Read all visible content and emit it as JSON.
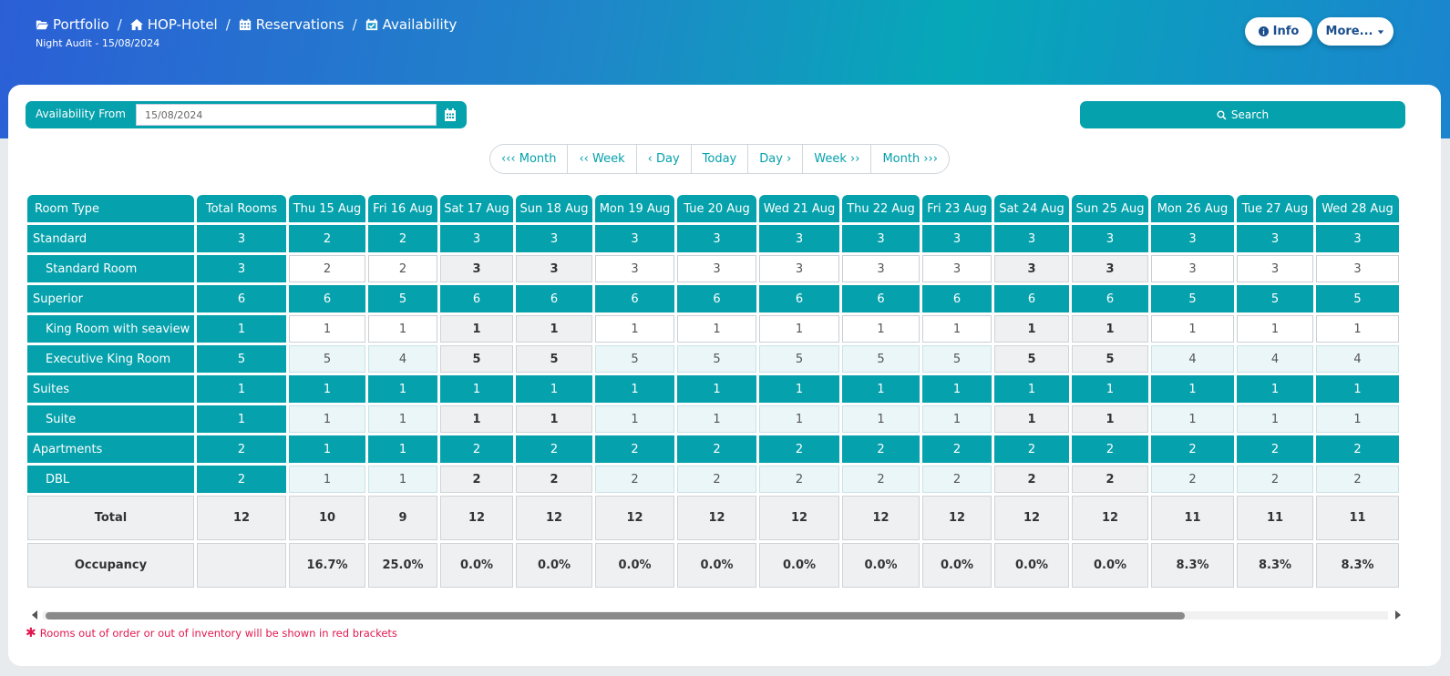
{
  "breadcrumb": {
    "items": [
      {
        "label": "Portfolio",
        "icon": "folder-open-icon"
      },
      {
        "label": "HOP-Hotel",
        "icon": "home-icon"
      },
      {
        "label": "Reservations",
        "icon": "calendar-icon"
      },
      {
        "label": "Availability",
        "icon": "calendar-check-icon"
      }
    ],
    "separator": "/"
  },
  "subtitle": "Night Audit - 15/08/2024",
  "header_buttons": {
    "info": "Info",
    "more": "More..."
  },
  "filter": {
    "label": "Availability From",
    "value": "15/08/2024"
  },
  "search_label": "Search",
  "nav": {
    "prev_month": "Month",
    "prev_week": "Week",
    "prev_day": "Day",
    "today": "Today",
    "next_day": "Day",
    "next_week": "Week",
    "next_month": "Month"
  },
  "table": {
    "col_room_type": "Room Type",
    "col_total_rooms": "Total Rooms",
    "dates": [
      "Thu 15 Aug",
      "Fri 16 Aug",
      "Sat 17 Aug",
      "Sun 18 Aug",
      "Mon 19 Aug",
      "Tue 20 Aug",
      "Wed 21 Aug",
      "Thu 22 Aug",
      "Fri 23 Aug",
      "Sat 24 Aug",
      "Sun 25 Aug",
      "Mon 26 Aug",
      "Tue 27 Aug",
      "Wed 28 Aug"
    ],
    "rows": [
      {
        "kind": "group",
        "name": "Standard",
        "total": "3",
        "values": [
          "2",
          "2",
          "3",
          "3",
          "3",
          "3",
          "3",
          "3",
          "3",
          "3",
          "3",
          "3",
          "3",
          "3"
        ]
      },
      {
        "kind": "room",
        "style": "white",
        "name": "Standard Room",
        "total": "3",
        "values": [
          "2",
          "2",
          "3",
          "3",
          "3",
          "3",
          "3",
          "3",
          "3",
          "3",
          "3",
          "3",
          "3",
          "3"
        ]
      },
      {
        "kind": "group",
        "name": "Superior",
        "total": "6",
        "values": [
          "6",
          "5",
          "6",
          "6",
          "6",
          "6",
          "6",
          "6",
          "6",
          "6",
          "6",
          "5",
          "5",
          "5"
        ]
      },
      {
        "kind": "room",
        "style": "white",
        "name": "King Room with seaview",
        "total": "1",
        "values": [
          "1",
          "1",
          "1",
          "1",
          "1",
          "1",
          "1",
          "1",
          "1",
          "1",
          "1",
          "1",
          "1",
          "1"
        ]
      },
      {
        "kind": "room",
        "style": "light",
        "name": "Executive King Room",
        "total": "5",
        "values": [
          "5",
          "4",
          "5",
          "5",
          "5",
          "5",
          "5",
          "5",
          "5",
          "5",
          "5",
          "4",
          "4",
          "4"
        ]
      },
      {
        "kind": "group",
        "name": "Suites",
        "total": "1",
        "values": [
          "1",
          "1",
          "1",
          "1",
          "1",
          "1",
          "1",
          "1",
          "1",
          "1",
          "1",
          "1",
          "1",
          "1"
        ]
      },
      {
        "kind": "room",
        "style": "light",
        "name": "Suite",
        "total": "1",
        "values": [
          "1",
          "1",
          "1",
          "1",
          "1",
          "1",
          "1",
          "1",
          "1",
          "1",
          "1",
          "1",
          "1",
          "1"
        ]
      },
      {
        "kind": "group",
        "name": "Apartments",
        "total": "2",
        "values": [
          "1",
          "1",
          "2",
          "2",
          "2",
          "2",
          "2",
          "2",
          "2",
          "2",
          "2",
          "2",
          "2",
          "2"
        ]
      },
      {
        "kind": "room",
        "style": "light",
        "name": "DBL",
        "total": "2",
        "values": [
          "1",
          "1",
          "2",
          "2",
          "2",
          "2",
          "2",
          "2",
          "2",
          "2",
          "2",
          "2",
          "2",
          "2"
        ]
      }
    ],
    "summary": [
      {
        "name": "Total",
        "total": "12",
        "values": [
          "10",
          "9",
          "12",
          "12",
          "12",
          "12",
          "12",
          "12",
          "12",
          "12",
          "12",
          "11",
          "11",
          "11"
        ]
      },
      {
        "name": "Occupancy",
        "total": "",
        "values": [
          "16.7%",
          "25.0%",
          "0.0%",
          "0.0%",
          "0.0%",
          "0.0%",
          "0.0%",
          "0.0%",
          "0.0%",
          "0.0%",
          "0.0%",
          "8.3%",
          "8.3%",
          "8.3%"
        ]
      }
    ]
  },
  "footnote": "Rooms out of order or out of inventory will be shown in red brackets",
  "colors": {
    "accent": "#05a1ac",
    "footnote": "#e0184f"
  }
}
